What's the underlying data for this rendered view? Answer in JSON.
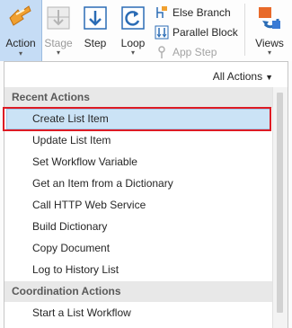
{
  "ribbon": {
    "action_label": "Action",
    "stage_label": "Stage",
    "step_label": "Step",
    "loop_label": "Loop",
    "else_branch_label": "Else Branch",
    "parallel_block_label": "Parallel Block",
    "app_step_label": "App Step",
    "views_label": "Views",
    "caret": "▾"
  },
  "menu": {
    "all_actions_label": "All Actions",
    "sections": [
      {
        "header": "Recent Actions",
        "items": [
          "Create List Item",
          "Update List Item",
          "Set Workflow Variable",
          "Get an Item from a Dictionary",
          "Call HTTP Web Service",
          "Build Dictionary",
          "Copy Document",
          "Log to History List"
        ]
      },
      {
        "header": "Coordination Actions",
        "items": [
          "Start a List Workflow"
        ]
      }
    ],
    "selected_item": "Create List Item"
  },
  "colors": {
    "selection_fill": "#cbe3f6",
    "highlight_border": "#dd1b24",
    "action_button_fill": "#c5dcf5"
  }
}
